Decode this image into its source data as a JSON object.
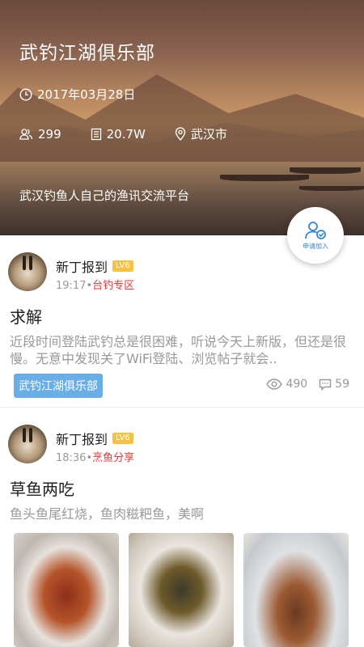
{
  "club": {
    "name": "武钓江湖俱乐部",
    "date": "2017年03月28日",
    "members": "299",
    "views": "20.7W",
    "location": "武汉市",
    "description": "武汉钓鱼人自己的渔讯交流平台",
    "join_label": "申请加入"
  },
  "posts": [
    {
      "author": "新丁报到",
      "level": "LV6",
      "time": "19:17",
      "separator": "•",
      "category": "台钓专区",
      "title": "求解",
      "body": "近段时间登陆武钓总是很困难，听说今天上新版，但还是很慢。无意中发现关了WiFi登陆、浏览帖子就会..",
      "tag": "武钓江湖俱乐部",
      "views": "490",
      "comments": "59"
    },
    {
      "author": "新丁报到",
      "level": "LV6",
      "time": "18:36",
      "separator": "•",
      "category": "烹鱼分享",
      "title": "草鱼两吃",
      "body": "鱼头鱼尾红烧，鱼肉糍粑鱼，美啊"
    }
  ],
  "colors": {
    "accent_blue": "#2f86d6",
    "tag_blue": "#6aaee8",
    "category_red": "#e53935",
    "level_gold": "#f5c242"
  }
}
